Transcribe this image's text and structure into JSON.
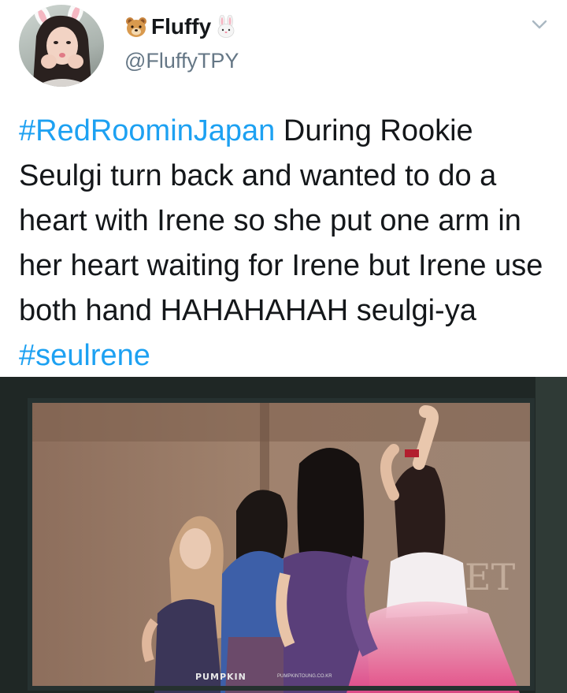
{
  "author": {
    "display_name": "Fluffy",
    "username": "@FluffyTPY",
    "name_emojis": [
      "bear-face-icon",
      "rabbit-face-icon"
    ]
  },
  "tweet": {
    "segments": [
      {
        "text": "#RedRoominJapan",
        "hashtag": true
      },
      {
        "text": " During Rookie Seulgi turn back and wanted to do a heart with Irene so she put one arm in her heart waiting for Irene but Irene use both hand HAHAHAHAH seulgi-ya ",
        "hashtag": false
      },
      {
        "text": "#seulrene",
        "hashtag": true
      }
    ]
  },
  "media": {
    "watermark": "PUMPKIN",
    "watermark_url": "PUMPKINTOUNG.CO.KR",
    "stage_letters": "ET"
  },
  "colors": {
    "hashtag": "#1da1f2",
    "username": "#657786",
    "text": "#14171a"
  }
}
